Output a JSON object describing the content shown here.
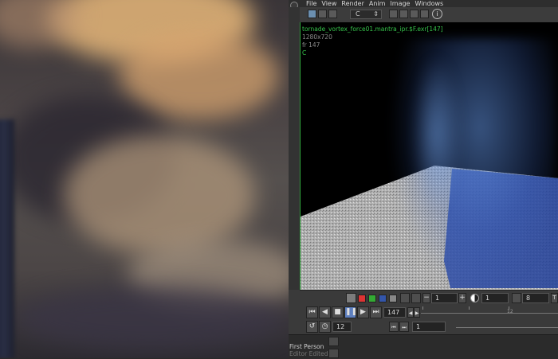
{
  "menu": [
    "File",
    "View",
    "Render",
    "Anim",
    "Image",
    "Windows"
  ],
  "toolbar": {
    "channel": "C",
    "channel_arrow": "⇕",
    "info_glyph": "ⓘ"
  },
  "viewport": {
    "filename": "tornade_vortex_force01.mantra_ipr.$F.exr[147]",
    "resolution": "1280x720",
    "frame_label": "fr 147",
    "channel": "C"
  },
  "timeline": {
    "minus": "−",
    "plus": "+",
    "field_a": "1",
    "field_b": "1",
    "field_c": "8",
    "field_d_label": "T",
    "current_frame": "147",
    "step": "12",
    "start": "1",
    "ruler_label": "12"
  },
  "bottom": {
    "camera": "First Person",
    "sub": "Editor Edited"
  },
  "colors": {
    "accent": "#35c24a",
    "play": "#5d7fbf"
  }
}
